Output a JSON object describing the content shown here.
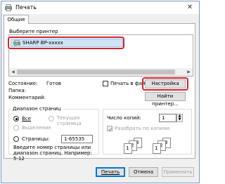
{
  "window": {
    "title": "Печать"
  },
  "tabs": [
    {
      "label": "Общие"
    }
  ],
  "printer_select": {
    "label": "Выберите принтер",
    "printers": [
      {
        "name": "SHARP BP-xxxxx",
        "selected": true
      }
    ]
  },
  "status": {
    "state_label": "Состояние:",
    "state_value": "Готов",
    "folder_label": "Папка:",
    "comment_label": "Комментарий:",
    "print_to_file_label": "Печать в файл",
    "settings_label": "Настройка",
    "find_printer_label": "Найти принтер..."
  },
  "page_range": {
    "group_label": "Диапазон страниц",
    "all_label": "Все",
    "selection_label": "Выделение",
    "current_page_label": "Текущая страница",
    "pages_label": "Страницы:",
    "pages_value": "1-65535",
    "hint": "Введите номер страницы или диапазон страниц.  Например: 5-12"
  },
  "copies": {
    "label": "Число копий:",
    "value": "1",
    "collate_label": "Разобрать по копиям",
    "collate_pages": [
      "1",
      "2",
      "3",
      "1",
      "2",
      "3"
    ]
  },
  "buttons": {
    "print": "Печать",
    "cancel": "Отмена",
    "apply": "Применить"
  },
  "colors": {
    "highlight": "#d6232e",
    "selection": "#cce4f7",
    "focus": "#0078d7"
  },
  "icons": {
    "app": "printer-icon",
    "printer_item": "printer-ready-icon",
    "close": "close-icon"
  }
}
